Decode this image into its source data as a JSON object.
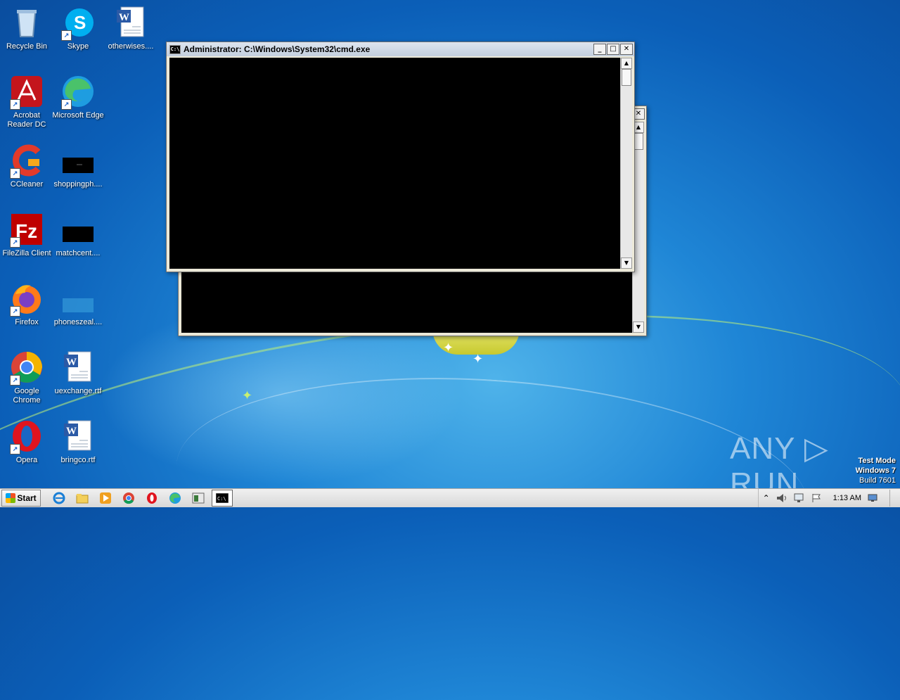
{
  "desktop_icons": [
    {
      "label": "Recycle Bin",
      "icon": "recycle-bin-icon"
    },
    {
      "label": "Skype",
      "icon": "skype-icon"
    },
    {
      "label": "otherwises....",
      "icon": "word-doc-icon"
    },
    {
      "label": "Acrobat Reader DC",
      "icon": "acrobat-icon"
    },
    {
      "label": "Microsoft Edge",
      "icon": "edge-icon"
    },
    {
      "label": "CCleaner",
      "icon": "ccleaner-icon"
    },
    {
      "label": "shoppingph....",
      "icon": "image-file-icon"
    },
    {
      "label": "FileZilla Client",
      "icon": "filezilla-icon"
    },
    {
      "label": "matchcent....",
      "icon": "image-file-icon"
    },
    {
      "label": "Firefox",
      "icon": "firefox-icon"
    },
    {
      "label": "phoneszeal....",
      "icon": "image-file-icon"
    },
    {
      "label": "Google Chrome",
      "icon": "chrome-icon"
    },
    {
      "label": "uexchange.rtf",
      "icon": "word-doc-icon"
    },
    {
      "label": "Opera",
      "icon": "opera-icon"
    },
    {
      "label": "bringco.rtf",
      "icon": "word-doc-icon"
    }
  ],
  "front_window": {
    "title": "Administrator: C:\\Windows\\System32\\cmd.exe",
    "icon_text": "C:\\",
    "minimize": "_",
    "maximize": "□",
    "close": "✕"
  },
  "back_window": {
    "close": "✕"
  },
  "scroll": {
    "up": "▲",
    "down": "▼"
  },
  "taskbar": {
    "start_label": "Start",
    "quick_launch": [
      "ie-icon",
      "explorer-icon",
      "media-player-icon",
      "chrome-icon",
      "opera-icon",
      "edge-icon",
      "window-icon",
      "cmd-icon"
    ],
    "tray_up": "⌃",
    "clock": "1:13 AM"
  },
  "watermark": "ANY ▷ RUN",
  "test_mode": {
    "line1": "Test Mode",
    "line2": "Windows 7",
    "line3": "Build 7601"
  }
}
